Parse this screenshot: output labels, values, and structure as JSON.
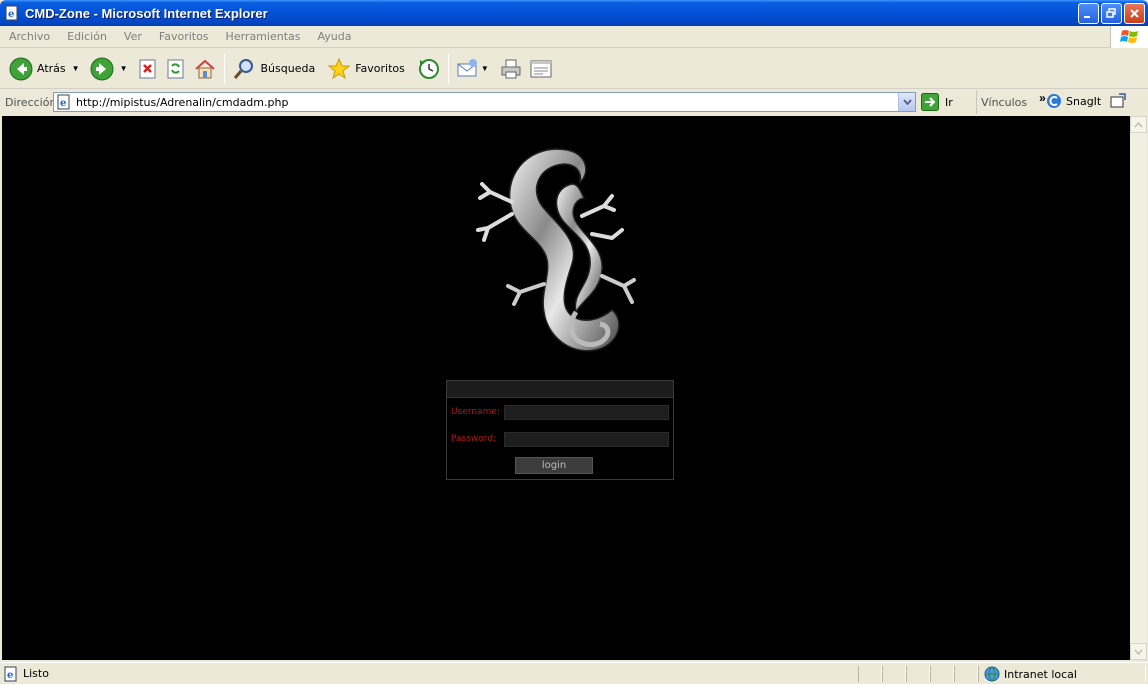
{
  "window": {
    "title": "CMD-Zone - Microsoft Internet Explorer"
  },
  "menu": {
    "items": [
      "Archivo",
      "Edición",
      "Ver",
      "Favoritos",
      "Herramientas",
      "Ayuda"
    ]
  },
  "toolbar": {
    "back_label": "Atrás",
    "search_label": "Búsqueda",
    "favorites_label": "Favoritos"
  },
  "address": {
    "label": "Dirección",
    "url": "http://mipistus/Adrenalin/cmdadm.php",
    "go_label": "Ir",
    "links_label": "Vínculos",
    "snagit_label": "SnagIt"
  },
  "login": {
    "username_label": "Username:",
    "username_value": "",
    "password_label": "Password:",
    "password_value": "",
    "button_label": "login"
  },
  "status": {
    "text": "Listo",
    "zone": "Intranet local"
  },
  "colors": {
    "titlebar": "#0453d8",
    "page_bg": "#000000",
    "login_label": "#b01818"
  },
  "icons": {
    "logo": "lizard-logo-icon"
  }
}
